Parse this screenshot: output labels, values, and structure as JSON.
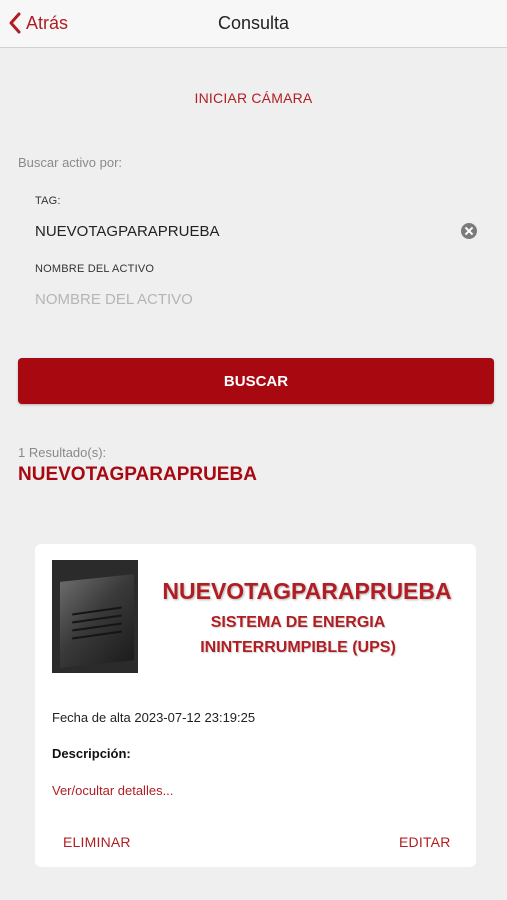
{
  "nav": {
    "back_label": "Atrás",
    "title": "Consulta"
  },
  "camera": {
    "start_label": "INICIAR CÁMARA"
  },
  "search": {
    "search_by_label": "Buscar activo por:",
    "tag_label": "TAG:",
    "tag_value": "NUEVOTAGPARAPRUEBA",
    "name_label": "NOMBRE DEL ACTIVO",
    "name_placeholder": "NOMBRE DEL ACTIVO",
    "button_label": "BUSCAR"
  },
  "results": {
    "count_label": "1 Resultado(s):",
    "heading": "NUEVOTAGPARAPRUEBA",
    "card": {
      "tag": "NUEVOTAGPARAPRUEBA",
      "subtitle_line1": "SISTEMA DE ENERGIA",
      "subtitle_line2": "ININTERRUMPIBLE (UPS)",
      "date_text": "Fecha de alta 2023-07-12 23:19:25",
      "description_label": "Descripción:",
      "toggle_details": "Ver/ocultar detalles...",
      "delete_label": "ELIMINAR",
      "edit_label": "EDITAR",
      "image_icon": "ups-device-photo"
    }
  },
  "colors": {
    "accent": "#b01e23",
    "button": "#a8080f",
    "background": "#efefef",
    "card": "#ffffff"
  }
}
